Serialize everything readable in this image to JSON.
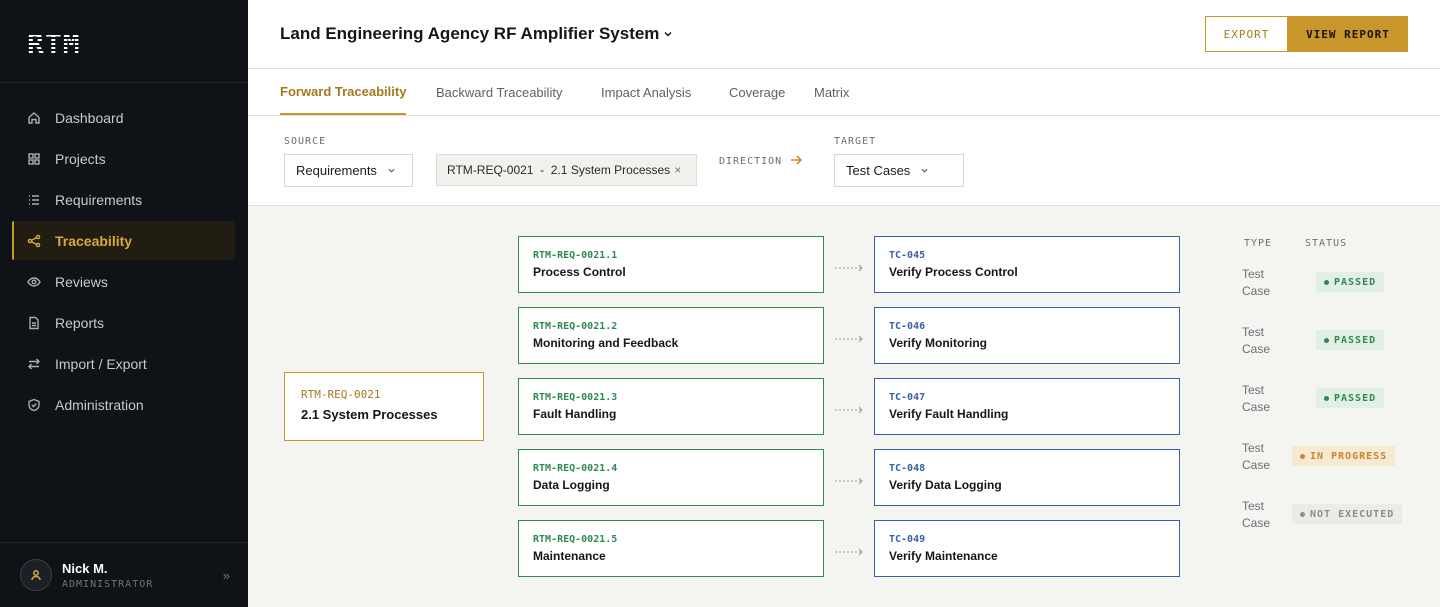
{
  "app": {
    "logo": "RTM"
  },
  "sidebar": {
    "items": [
      {
        "label": "Dashboard",
        "icon": "home-icon"
      },
      {
        "label": "Projects",
        "icon": "grid-icon"
      },
      {
        "label": "Requirements",
        "icon": "list-icon"
      },
      {
        "label": "Traceability",
        "icon": "share-icon",
        "active": true
      },
      {
        "label": "Reviews",
        "icon": "eye-icon"
      },
      {
        "label": "Reports",
        "icon": "document-icon"
      },
      {
        "label": "Import / Export",
        "icon": "swap-icon"
      },
      {
        "label": "Administration",
        "icon": "shield-icon"
      }
    ],
    "user": {
      "name": "Nick M.",
      "role": "ADMINISTRATOR",
      "expand_glyph": "»"
    }
  },
  "header": {
    "project_title": "Land Engineering Agency RF Amplifier System",
    "export_label": "EXPORT",
    "view_report_label": "VIEW REPORT"
  },
  "tabs": [
    {
      "label": "Forward Traceability",
      "active": true
    },
    {
      "label": "Backward Traceability"
    },
    {
      "label": "Impact Analysis"
    },
    {
      "label": "Coverage"
    },
    {
      "label": "Matrix"
    }
  ],
  "filters": {
    "source_label": "SOURCE",
    "source_value": "Requirements",
    "selected_item": "RTM-REQ-0021  -  2.1 System Processes",
    "remove_glyph": "×",
    "direction_label": "DIRECTION",
    "target_label": "TARGET",
    "target_value": "Test Cases"
  },
  "trace": {
    "root": {
      "id": "RTM-REQ-0021",
      "title": "2.1 System Processes"
    },
    "type_header": "TYPE",
    "status_header": "STATUS",
    "rows": [
      {
        "req_id": "RTM-REQ-0021.1",
        "req_title": "Process Control",
        "tc_id": "TC-045",
        "tc_title": "Verify Process Control",
        "type": "Test Case",
        "status": "PASSED"
      },
      {
        "req_id": "RTM-REQ-0021.2",
        "req_title": "Monitoring and Feedback",
        "tc_id": "TC-046",
        "tc_title": "Verify Monitoring",
        "type": "Test Case",
        "status": "PASSED"
      },
      {
        "req_id": "RTM-REQ-0021.3",
        "req_title": "Fault Handling",
        "tc_id": "TC-047",
        "tc_title": "Verify Fault Handling",
        "type": "Test Case",
        "status": "PASSED"
      },
      {
        "req_id": "RTM-REQ-0021.4",
        "req_title": "Data Logging",
        "tc_id": "TC-048",
        "tc_title": "Verify Data Logging",
        "type": "Test Case",
        "status": "IN PROGRESS"
      },
      {
        "req_id": "RTM-REQ-0021.5",
        "req_title": "Maintenance",
        "tc_id": "TC-049",
        "tc_title": "Verify Maintenance",
        "type": "Test Case",
        "status": "NOT EXECUTED"
      }
    ]
  },
  "colors": {
    "accent": "#c8962b",
    "requirement": "#2f8a52",
    "test_case": "#3a5ea8",
    "sidebar_bg": "#0f1318"
  }
}
